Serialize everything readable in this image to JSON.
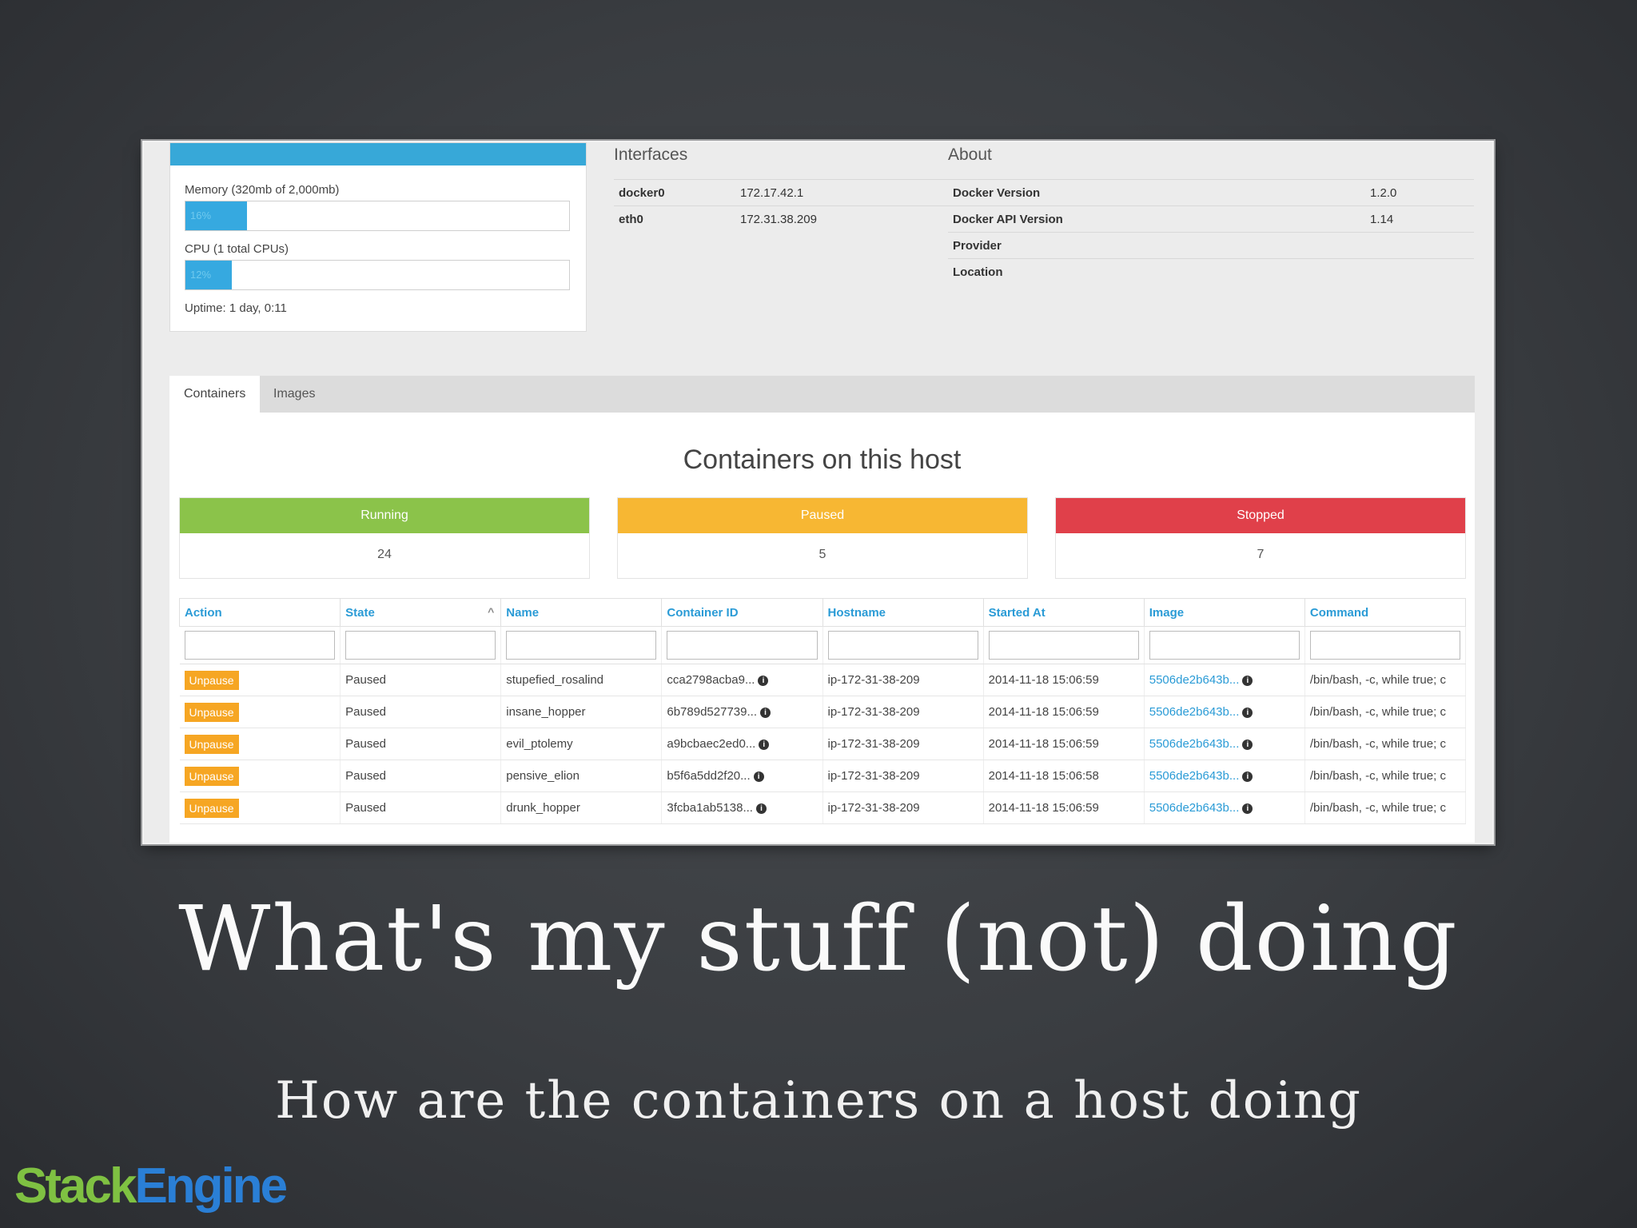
{
  "host": {
    "memory_label": "Memory (320mb of 2,000mb)",
    "memory_percent": "16%",
    "memory_value": 16,
    "cpu_label": "CPU (1 total CPUs)",
    "cpu_percent": "12%",
    "cpu_value": 12,
    "uptime": "Uptime: 1 day, 0:11"
  },
  "interfaces": {
    "title": "Interfaces",
    "rows": [
      {
        "name": "docker0",
        "ip": "172.17.42.1"
      },
      {
        "name": "eth0",
        "ip": "172.31.38.209"
      }
    ]
  },
  "about": {
    "title": "About",
    "rows": [
      {
        "key": "Docker Version",
        "value": "1.2.0"
      },
      {
        "key": "Docker API Version",
        "value": "1.14"
      },
      {
        "key": "Provider",
        "value": ""
      },
      {
        "key": "Location",
        "value": ""
      }
    ]
  },
  "tabs": [
    {
      "label": "Containers"
    },
    {
      "label": "Images"
    }
  ],
  "containers": {
    "title": "Containers on this host",
    "states": [
      {
        "label": "Running",
        "count": "24",
        "color": "#8bc34a"
      },
      {
        "label": "Paused",
        "count": "5",
        "color": "#f7b733"
      },
      {
        "label": "Stopped",
        "count": "7",
        "color": "#e0404a"
      }
    ],
    "columns": [
      "Action",
      "State",
      "Name",
      "Container ID",
      "Hostname",
      "Started At",
      "Image",
      "Command"
    ],
    "rows": [
      {
        "action": "Unpause",
        "state": "Paused",
        "name": "stupefied_rosalind",
        "id": "cca2798acba9...",
        "hostname": "ip-172-31-38-209",
        "started": "2014-11-18 15:06:59",
        "image": "5506de2b643b...",
        "command": "/bin/bash, -c, while true; c"
      },
      {
        "action": "Unpause",
        "state": "Paused",
        "name": "insane_hopper",
        "id": "6b789d527739...",
        "hostname": "ip-172-31-38-209",
        "started": "2014-11-18 15:06:59",
        "image": "5506de2b643b...",
        "command": "/bin/bash, -c, while true; c"
      },
      {
        "action": "Unpause",
        "state": "Paused",
        "name": "evil_ptolemy",
        "id": "a9bcbaec2ed0...",
        "hostname": "ip-172-31-38-209",
        "started": "2014-11-18 15:06:59",
        "image": "5506de2b643b...",
        "command": "/bin/bash, -c, while true; c"
      },
      {
        "action": "Unpause",
        "state": "Paused",
        "name": "pensive_elion",
        "id": "b5f6a5dd2f20...",
        "hostname": "ip-172-31-38-209",
        "started": "2014-11-18 15:06:58",
        "image": "5506de2b643b...",
        "command": "/bin/bash, -c, while true; c"
      },
      {
        "action": "Unpause",
        "state": "Paused",
        "name": "drunk_hopper",
        "id": "3fcba1ab5138...",
        "hostname": "ip-172-31-38-209",
        "started": "2014-11-18 15:06:59",
        "image": "5506de2b643b...",
        "command": "/bin/bash, -c, while true; c"
      }
    ]
  },
  "slide": {
    "headline": "What's my stuff (not) doing",
    "subline": "How are the containers on a host doing",
    "logo_part1": "Stack",
    "logo_part2": "Engine"
  },
  "icons": {
    "info": "info-icon",
    "sort": "chevron-up-icon"
  }
}
